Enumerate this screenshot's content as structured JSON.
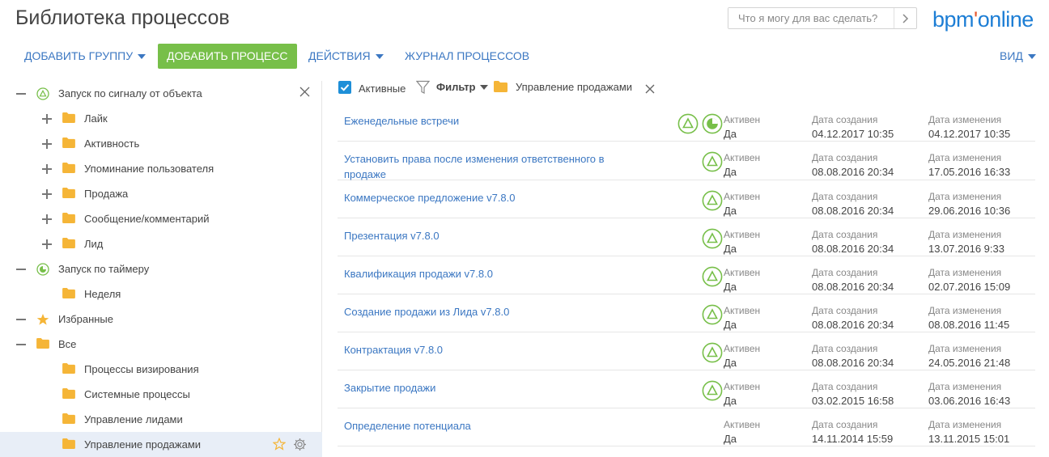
{
  "header": {
    "title": "Библиотека процессов",
    "search_placeholder": "Что я могу для вас сделать?",
    "logo_text": "bpm",
    "logo_dot": "'",
    "logo_text2": "online"
  },
  "toolbar": {
    "add_group": "ДОБАВИТЬ ГРУППУ",
    "add_process": "ДОБАВИТЬ ПРОЦЕСС",
    "actions": "ДЕЙСТВИЯ",
    "journal": "ЖУРНАЛ ПРОЦЕССОВ",
    "view": "ВИД"
  },
  "colors": {
    "accent": "#3b77c2",
    "green": "#77bf49",
    "folder": "#f5b537",
    "logo_blue": "#1d7ed5",
    "logo_orange": "#e7562b"
  },
  "tree": [
    {
      "label": "Запуск по сигналу от объекта",
      "icon": "signal-triangle-icon",
      "level": 0,
      "expanded": true
    },
    {
      "label": "Лайк",
      "icon": "folder-icon",
      "level": 1,
      "expanded": false
    },
    {
      "label": "Активность",
      "icon": "folder-icon",
      "level": 1,
      "expanded": false
    },
    {
      "label": "Упоминание пользователя",
      "icon": "folder-icon",
      "level": 1,
      "expanded": false
    },
    {
      "label": "Продажа",
      "icon": "folder-icon",
      "level": 1,
      "expanded": false
    },
    {
      "label": "Сообщение/комментарий",
      "icon": "folder-icon",
      "level": 1,
      "expanded": false
    },
    {
      "label": "Лид",
      "icon": "folder-icon",
      "level": 1,
      "expanded": false
    },
    {
      "label": "Запуск по таймеру",
      "icon": "timer-icon",
      "level": 0,
      "expanded": true
    },
    {
      "label": "Неделя",
      "icon": "folder-icon",
      "level": 1
    },
    {
      "label": "Избранные",
      "icon": "star-icon",
      "level": 0,
      "expanded": true
    },
    {
      "label": "Все",
      "icon": "folder-icon",
      "level": 0,
      "expanded": true
    },
    {
      "label": "Процессы визирования",
      "icon": "folder-icon",
      "level": 1
    },
    {
      "label": "Системные процессы",
      "icon": "folder-icon",
      "level": 1
    },
    {
      "label": "Управление лидами",
      "icon": "folder-icon",
      "level": 1
    },
    {
      "label": "Управление продажами",
      "icon": "folder-icon",
      "level": 1,
      "selected": true
    }
  ],
  "filter": {
    "active_label": "Активные",
    "filter_label": "Фильтр",
    "folder_label": "Управление продажами"
  },
  "columns": {
    "active": "Активен",
    "created": "Дата создания",
    "modified": "Дата изменения"
  },
  "processes": [
    {
      "name": "Еженедельные встречи",
      "icons": [
        "signal-triangle-icon",
        "timer-icon"
      ],
      "active": "Да",
      "created": "04.12.2017 10:35",
      "modified": "04.12.2017 10:35"
    },
    {
      "name": "Установить права после изменения ответственного в продаже",
      "icons": [
        "signal-triangle-icon"
      ],
      "active": "Да",
      "created": "08.08.2016 20:34",
      "modified": "17.05.2016 16:33"
    },
    {
      "name": "Коммерческое предложение v7.8.0",
      "icons": [
        "signal-triangle-icon"
      ],
      "active": "Да",
      "created": "08.08.2016 20:34",
      "modified": "29.06.2016 10:36"
    },
    {
      "name": "Презентация v7.8.0",
      "icons": [
        "signal-triangle-icon"
      ],
      "active": "Да",
      "created": "08.08.2016 20:34",
      "modified": "13.07.2016 9:33"
    },
    {
      "name": "Квалификация продажи v7.8.0",
      "icons": [
        "signal-triangle-icon"
      ],
      "active": "Да",
      "created": "08.08.2016 20:34",
      "modified": "02.07.2016 15:09"
    },
    {
      "name": "Создание продажи из Лида v7.8.0",
      "icons": [
        "signal-triangle-icon"
      ],
      "active": "Да",
      "created": "08.08.2016 20:34",
      "modified": "08.08.2016 11:45"
    },
    {
      "name": "Контрактация v7.8.0",
      "icons": [
        "signal-triangle-icon"
      ],
      "active": "Да",
      "created": "08.08.2016 20:34",
      "modified": "24.05.2016 21:48"
    },
    {
      "name": "Закрытие продажи",
      "icons": [
        "signal-triangle-icon"
      ],
      "active": "Да",
      "created": "03.02.2015 16:58",
      "modified": "03.06.2016 16:43"
    },
    {
      "name": "Определение потенциала",
      "icons": [],
      "active": "Да",
      "created": "14.11.2014 15:59",
      "modified": "13.11.2015 15:01"
    }
  ]
}
